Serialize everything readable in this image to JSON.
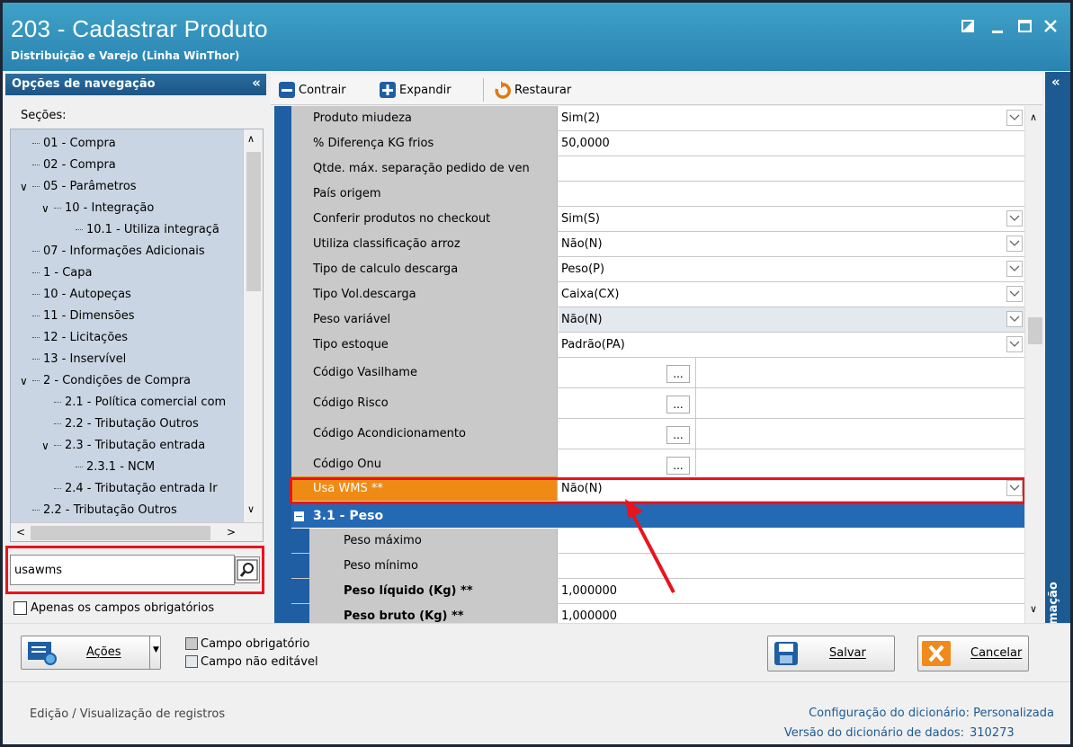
{
  "window": {
    "title": "203 - Cadastrar  Produto",
    "subtitle": "Distribuição e Varejo (Linha WinThor)",
    "controls": [
      "restore",
      "minimize",
      "maximize",
      "close"
    ]
  },
  "nav": {
    "header": "Opções de navegação",
    "collapse_glyph": "«",
    "sections_label": "Seções:",
    "tree": [
      {
        "label": "01 - Compra",
        "level": 0,
        "expanded": null
      },
      {
        "label": "02 - Compra",
        "level": 0,
        "expanded": null
      },
      {
        "label": "05 - Parâmetros",
        "level": 0,
        "expanded": true
      },
      {
        "label": "10 - Integração",
        "level": 1,
        "expanded": true
      },
      {
        "label": "10.1 - Utiliza integraçã",
        "level": 2,
        "expanded": null
      },
      {
        "label": "07 - Informações Adicionais",
        "level": 0,
        "expanded": null
      },
      {
        "label": "1 - Capa",
        "level": 0,
        "expanded": null
      },
      {
        "label": "10 - Autopeças",
        "level": 0,
        "expanded": null
      },
      {
        "label": "11 - Dimensões",
        "level": 0,
        "expanded": null
      },
      {
        "label": "12 - Licitações",
        "level": 0,
        "expanded": null
      },
      {
        "label": "13 - Inservível",
        "level": 0,
        "expanded": null
      },
      {
        "label": "2 - Condições de Compra",
        "level": 0,
        "expanded": true
      },
      {
        "label": "2.1 - Política comercial com",
        "level": 1,
        "expanded": null
      },
      {
        "label": "2.2 - Tributação Outros",
        "level": 1,
        "expanded": null
      },
      {
        "label": "2.3 - Tributação entrada",
        "level": 1,
        "expanded": true
      },
      {
        "label": "2.3.1 - NCM",
        "level": 2,
        "expanded": null
      },
      {
        "label": "2.4 - Tributação entrada Ir",
        "level": 1,
        "expanded": null
      },
      {
        "label": "2.2 - Tributação Outros",
        "level": 0,
        "expanded": null
      }
    ],
    "search_value": "usawms",
    "search_placeholder": "",
    "required_only_label": "Apenas os campos obrigatórios"
  },
  "toolbar": {
    "contrair": "Contrair",
    "expandir": "Expandir",
    "restaurar": "Restaurar"
  },
  "grid": {
    "rows": [
      {
        "label": "Produto miudeza",
        "value": "Sim(2)",
        "type": "dropdown"
      },
      {
        "label": "% Diferença KG frios",
        "value": "50,0000",
        "type": "text"
      },
      {
        "label": "Qtde. máx. separação pedido de ven",
        "value": "",
        "type": "text"
      },
      {
        "label": "País origem",
        "value": "",
        "type": "text"
      },
      {
        "label": "Conferir produtos no checkout",
        "value": "Sim(S)",
        "type": "dropdown"
      },
      {
        "label": "Utiliza classificação arroz",
        "value": "Não(N)",
        "type": "dropdown"
      },
      {
        "label": "Tipo de calculo descarga",
        "value": "Peso(P)",
        "type": "dropdown"
      },
      {
        "label": "Tipo Vol.descarga",
        "value": "Caixa(CX)",
        "type": "dropdown"
      },
      {
        "label": "Peso variável",
        "value": "Não(N)",
        "type": "dropdown",
        "readonly": true
      },
      {
        "label": "Tipo estoque",
        "value": "Padrão(PA)",
        "type": "dropdown"
      },
      {
        "label": "Código Vasilhame",
        "value": "",
        "type": "lookup"
      },
      {
        "label": "Código Risco",
        "value": "",
        "type": "lookup"
      },
      {
        "label": "Código Acondicionamento",
        "value": "",
        "type": "lookup"
      },
      {
        "label": "Código Onu",
        "value": "",
        "type": "lookup"
      }
    ],
    "highlight_row": {
      "label": "Usa WMS **",
      "value": "Não(N)"
    },
    "section": {
      "title": "3.1 - Peso"
    },
    "sub_rows": [
      {
        "label": "Peso máximo",
        "value": "",
        "bold": false
      },
      {
        "label": "Peso mínimo",
        "value": "",
        "bold": false
      },
      {
        "label": "Peso líquido (Kg) **",
        "value": "1,000000",
        "bold": true
      },
      {
        "label": "Peso bruto (Kg) **",
        "value": "1,000000",
        "bold": true
      }
    ],
    "ellipsis": "..."
  },
  "info_panel": {
    "label": "Informação",
    "collapse_glyph": "«"
  },
  "bottom": {
    "acoes": "Ações",
    "legend_required": "Campo obrigatório",
    "legend_not_editable": "Campo não editável",
    "salvar": "Salvar",
    "cancelar": "Cancelar"
  },
  "status": {
    "mode": "Edição / Visualização de registros",
    "dict_config_label": "Configuração do dicionário:",
    "dict_config_value": "Personalizada",
    "dict_version_label": "Versão do dicionário de dados:",
    "dict_version_value": "310273"
  },
  "colors": {
    "title_bar": "#3fa2c8",
    "nav_header": "#1c5585",
    "grid_gutter": "#1f5ea3",
    "section_header": "#2469b3",
    "required_label": "#c9c9c9",
    "highlight_label": "#ef8b14",
    "annotation_red": "#e8141e"
  }
}
